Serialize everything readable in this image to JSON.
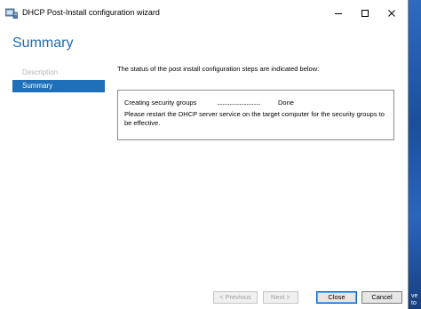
{
  "window": {
    "title": "DHCP Post-Install configuration wizard",
    "minimize_glyph": "—",
    "maximize_glyph": "☐",
    "close_glyph": "✕"
  },
  "header": {
    "title": "Summary"
  },
  "sidebar": {
    "items": [
      {
        "label": "Description",
        "state": "disabled"
      },
      {
        "label": "Summary",
        "state": "selected"
      }
    ]
  },
  "main": {
    "intro": "The status of the post install configuration steps are indicated below:",
    "steps": [
      {
        "name": "Creating security groups",
        "dots": "...............................",
        "status": "Done"
      }
    ],
    "message": "Please restart the DHCP server service on the target computer for the security groups to be effective."
  },
  "footer": {
    "previous_label": "< Previous",
    "next_label": "Next >",
    "close_label": "Close",
    "cancel_label": "Cancel"
  },
  "background": {
    "text_1": "ve",
    "text_2": "to"
  },
  "colors": {
    "accent": "#1e6cb3",
    "selected_bg": "#1c6fb8",
    "desktop": "#1f5aa6"
  }
}
